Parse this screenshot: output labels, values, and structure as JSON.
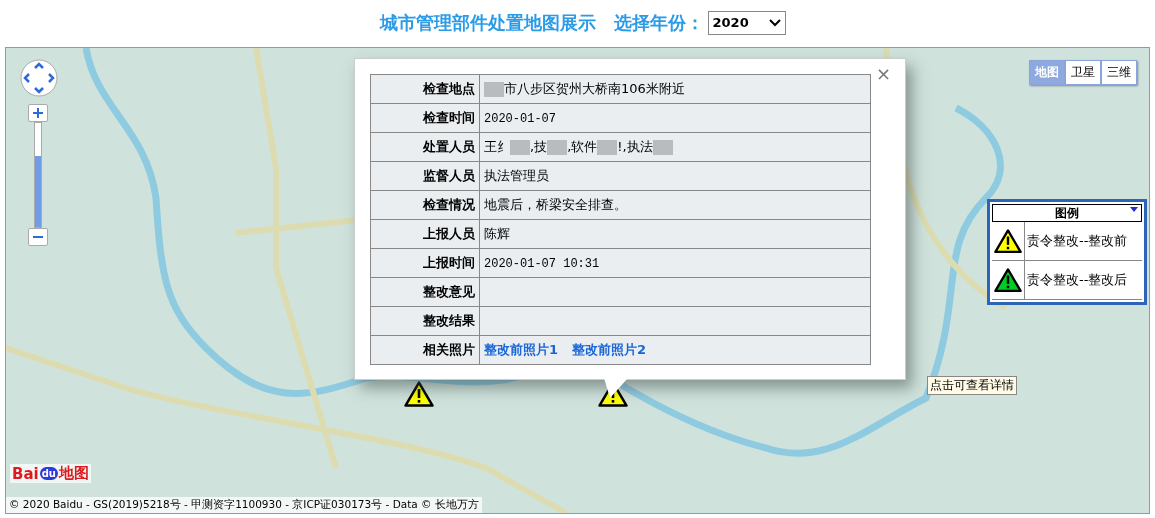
{
  "header": {
    "title": "城市管理部件处置地图展示",
    "year_label": "选择年份：",
    "year_value": "2020"
  },
  "map": {
    "map_types": [
      {
        "label": "地图",
        "selected": true
      },
      {
        "label": "卫星",
        "selected": false
      },
      {
        "label": "三维",
        "selected": false
      }
    ],
    "zoom": {
      "level": 0.68
    },
    "markers": [
      {
        "kind": "before"
      },
      {
        "kind": "before"
      }
    ],
    "popup": {
      "rows": [
        {
          "label": "检查地点",
          "value": [
            {
              "kind": "blur"
            },
            {
              "kind": "text",
              "text": "市八步区贺州大桥南106米附近"
            }
          ]
        },
        {
          "label": "检查时间",
          "value": [
            {
              "kind": "date",
              "text": "2020-01-07"
            }
          ]
        },
        {
          "label": "处置人员",
          "value": [
            {
              "kind": "text",
              "text": "王纟"
            },
            {
              "kind": "blur"
            },
            {
              "kind": "text",
              "text": ",技"
            },
            {
              "kind": "blur"
            },
            {
              "kind": "text",
              "text": ",软件"
            },
            {
              "kind": "blur"
            },
            {
              "kind": "text",
              "text": "!,执法"
            },
            {
              "kind": "blur"
            }
          ]
        },
        {
          "label": "监督人员",
          "value": [
            {
              "kind": "text",
              "text": "执法管理员"
            }
          ]
        },
        {
          "label": "检查情况",
          "value": [
            {
              "kind": "text",
              "text": "地震后，桥梁安全排查。"
            }
          ]
        },
        {
          "label": "上报人员",
          "value": [
            {
              "kind": "text",
              "text": "陈辉"
            }
          ]
        },
        {
          "label": "上报时间",
          "value": [
            {
              "kind": "date",
              "text": "2020-01-07 10:31"
            }
          ]
        },
        {
          "label": "整改意见",
          "value": []
        },
        {
          "label": "整改结果",
          "value": []
        },
        {
          "label": "相关照片",
          "value": [
            {
              "kind": "link",
              "text": "整改前照片1"
            },
            {
              "kind": "link",
              "text": "整改前照片2"
            }
          ]
        }
      ],
      "close": "×"
    },
    "legend": {
      "title": "图例",
      "items": [
        {
          "kind": "before",
          "label": "责令整改--整改前"
        },
        {
          "kind": "after",
          "label": "责令整改--整改后"
        }
      ]
    },
    "tooltip": "点击可查看详情",
    "logo": {
      "part_1": "Bai",
      "part_2": "du",
      "part_3": "地图"
    },
    "copyright": "© 2020 Baidu - GS(2019)5218号 - 甲测资字1100930 - 京ICP证030173号 - Data © 长地万方"
  }
}
